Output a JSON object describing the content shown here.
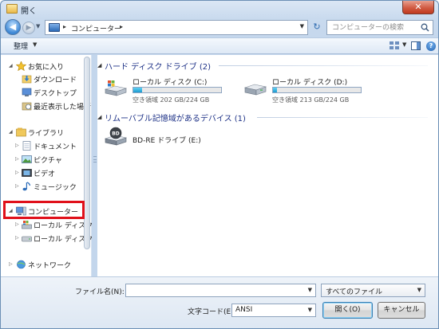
{
  "window": {
    "title": "開く",
    "close_glyph": "✕"
  },
  "nav": {
    "back_glyph": "◀",
    "forward_glyph": "▶",
    "history_glyph": "▼",
    "breadcrumb": "コンピューター",
    "crumb_sep": "▸",
    "refresh_glyph": "↻",
    "search_placeholder": "コンピューターの検索"
  },
  "toolbar": {
    "organize_label": "整理",
    "caret": "▼",
    "help_glyph": "?"
  },
  "sidebar": {
    "favorites": {
      "label": "お気に入り",
      "items": [
        "ダウンロード",
        "デスクトップ",
        "最近表示した場所"
      ]
    },
    "libraries": {
      "label": "ライブラリ",
      "items": [
        "ドキュメント",
        "ピクチャ",
        "ビデオ",
        "ミュージック"
      ]
    },
    "computer": {
      "label": "コンピューター",
      "items": [
        "ローカル ディスク (C:)",
        "ローカル ディスク (D:)"
      ]
    },
    "network": {
      "label": "ネットワーク"
    },
    "expanded_arrow": "◢",
    "collapsed_arrow": "▷"
  },
  "content": {
    "hdd_group": {
      "title": "ハード ディスク ドライブ (2)"
    },
    "drives": [
      {
        "name": "ローカル ディスク (C:)",
        "free": "空き領域 202 GB/224 GB",
        "used_fraction": 0.098
      },
      {
        "name": "ローカル ディスク (D:)",
        "free": "空き領域 213 GB/224 GB",
        "used_fraction": 0.049
      }
    ],
    "removable_group": {
      "title": "リムーバブル記憶域があるデバイス (1)"
    },
    "bd_drive": {
      "name": "BD-RE ドライブ (E:)",
      "badge": "BD"
    },
    "group_toggle": "◢"
  },
  "bottom": {
    "filename_label": "ファイル名(N):",
    "filename_value": "",
    "filetype_value": "すべてのファイル",
    "encoding_label": "文字コード(E):",
    "encoding_value": "ANSI",
    "open_label": "開く(O)",
    "cancel_label": "キャンセル",
    "caret": "▼"
  },
  "colors": {
    "highlight": "#e0101a",
    "group_title": "#1e3287",
    "drive_fill": "#1d9bd0"
  }
}
